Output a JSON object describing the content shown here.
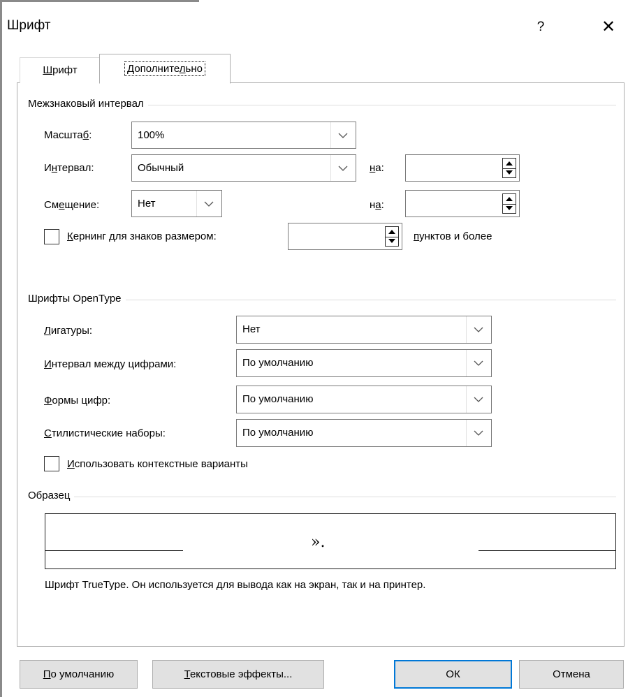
{
  "window": {
    "title": "Шрифт",
    "help_glyph": "?",
    "close_glyph": "✕"
  },
  "tabs": {
    "font": "Шрифт",
    "advanced": "Дополнительно"
  },
  "character_spacing": {
    "section_title": "Межзнаковый интервал",
    "scale_label": "Масштаб:",
    "scale_value": "100%",
    "spacing_label": "Интервал:",
    "spacing_value": "Обычный",
    "spacing_by_label": "на:",
    "spacing_by_value": "",
    "position_label": "Смещение:",
    "position_value": "Нет",
    "position_by_label": "на:",
    "position_by_value": "",
    "kerning_label": "Кернинг для знаков размером:",
    "kerning_checked": false,
    "kerning_value": "",
    "kerning_suffix": "пунктов и более"
  },
  "opentype": {
    "section_title": "Шрифты OpenType",
    "ligatures_label": "Лигатуры:",
    "ligatures_value": "Нет",
    "number_spacing_label": "Интервал между цифрами:",
    "number_spacing_value": "По умолчанию",
    "number_forms_label": "Формы цифр:",
    "number_forms_value": "По умолчанию",
    "stylistic_sets_label": "Стилистические наборы:",
    "stylistic_sets_value": "По умолчанию",
    "contextual_label": "Использовать контекстные варианты",
    "contextual_checked": false
  },
  "preview": {
    "section_title": "Образец",
    "sample_text": "».",
    "description": "Шрифт TrueType. Он используется для вывода как на экран, так и на принтер."
  },
  "buttons": {
    "default": "По умолчанию",
    "text_effects": "Текстовые эффекты...",
    "ok": "ОК",
    "cancel": "Отмена"
  },
  "colors": {
    "ok_border": "#0078d7",
    "button_bg": "#e1e1e1",
    "window_bg": "#ffffff"
  }
}
